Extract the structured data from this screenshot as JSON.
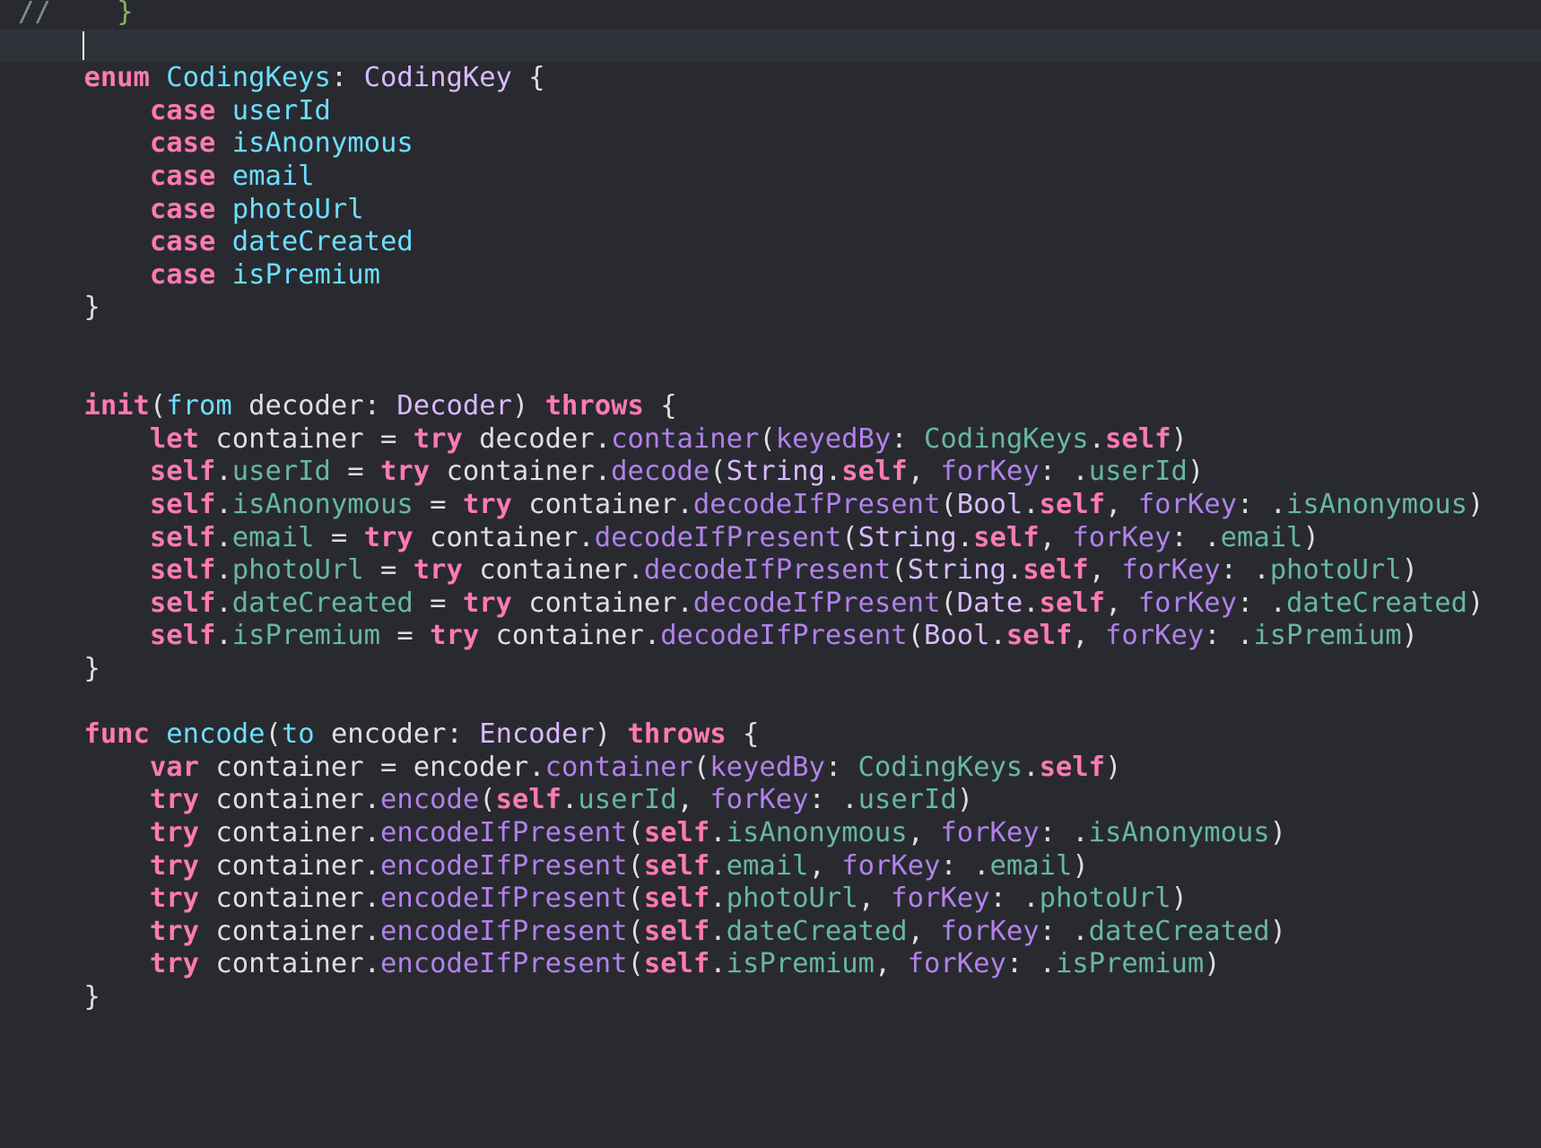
{
  "editor": {
    "theme_colors": {
      "background": "#292a30",
      "current_line": "#2f3239",
      "plain": "#dfdfe0",
      "keyword": "#ff7ab2",
      "type": "#dabaff",
      "declaration": "#6bdfff",
      "member": "#67b7a4",
      "method": "#b281eb",
      "comment": "#7f8c98"
    },
    "current_line_index": 1,
    "lines": [
      [
        {
          "t": "//",
          "c": "comment"
        },
        {
          "t": "    ",
          "c": "plain"
        },
        {
          "t": "}",
          "c": "cmtfold"
        }
      ],
      [],
      [
        {
          "t": "    ",
          "c": "plain"
        },
        {
          "t": "enum",
          "c": "kw"
        },
        {
          "t": " ",
          "c": "plain"
        },
        {
          "t": "CodingKeys",
          "c": "decl"
        },
        {
          "t": ": ",
          "c": "plain"
        },
        {
          "t": "CodingKey",
          "c": "type"
        },
        {
          "t": " {",
          "c": "plain"
        }
      ],
      [
        {
          "t": "        ",
          "c": "plain"
        },
        {
          "t": "case",
          "c": "kw"
        },
        {
          "t": " ",
          "c": "plain"
        },
        {
          "t": "userId",
          "c": "decl"
        }
      ],
      [
        {
          "t": "        ",
          "c": "plain"
        },
        {
          "t": "case",
          "c": "kw"
        },
        {
          "t": " ",
          "c": "plain"
        },
        {
          "t": "isAnonymous",
          "c": "decl"
        }
      ],
      [
        {
          "t": "        ",
          "c": "plain"
        },
        {
          "t": "case",
          "c": "kw"
        },
        {
          "t": " ",
          "c": "plain"
        },
        {
          "t": "email",
          "c": "decl"
        }
      ],
      [
        {
          "t": "        ",
          "c": "plain"
        },
        {
          "t": "case",
          "c": "kw"
        },
        {
          "t": " ",
          "c": "plain"
        },
        {
          "t": "photoUrl",
          "c": "decl"
        }
      ],
      [
        {
          "t": "        ",
          "c": "plain"
        },
        {
          "t": "case",
          "c": "kw"
        },
        {
          "t": " ",
          "c": "plain"
        },
        {
          "t": "dateCreated",
          "c": "decl"
        }
      ],
      [
        {
          "t": "        ",
          "c": "plain"
        },
        {
          "t": "case",
          "c": "kw"
        },
        {
          "t": " ",
          "c": "plain"
        },
        {
          "t": "isPremium",
          "c": "decl"
        }
      ],
      [
        {
          "t": "    }",
          "c": "plain"
        }
      ],
      [],
      [],
      [
        {
          "t": "    ",
          "c": "plain"
        },
        {
          "t": "init",
          "c": "kw"
        },
        {
          "t": "(",
          "c": "plain"
        },
        {
          "t": "from",
          "c": "decl"
        },
        {
          "t": " decoder: ",
          "c": "plain"
        },
        {
          "t": "Decoder",
          "c": "type"
        },
        {
          "t": ") ",
          "c": "plain"
        },
        {
          "t": "throws",
          "c": "kw"
        },
        {
          "t": " {",
          "c": "plain"
        }
      ],
      [
        {
          "t": "        ",
          "c": "plain"
        },
        {
          "t": "let",
          "c": "kw"
        },
        {
          "t": " container = ",
          "c": "plain"
        },
        {
          "t": "try",
          "c": "kw"
        },
        {
          "t": " decoder.",
          "c": "plain"
        },
        {
          "t": "container",
          "c": "method"
        },
        {
          "t": "(",
          "c": "plain"
        },
        {
          "t": "keyedBy",
          "c": "method"
        },
        {
          "t": ": ",
          "c": "plain"
        },
        {
          "t": "CodingKeys",
          "c": "member"
        },
        {
          "t": ".",
          "c": "plain"
        },
        {
          "t": "self",
          "c": "kw"
        },
        {
          "t": ")",
          "c": "plain"
        }
      ],
      [
        {
          "t": "        ",
          "c": "plain"
        },
        {
          "t": "self",
          "c": "kw"
        },
        {
          "t": ".",
          "c": "plain"
        },
        {
          "t": "userId",
          "c": "member"
        },
        {
          "t": " = ",
          "c": "plain"
        },
        {
          "t": "try",
          "c": "kw"
        },
        {
          "t": " container.",
          "c": "plain"
        },
        {
          "t": "decode",
          "c": "method"
        },
        {
          "t": "(",
          "c": "plain"
        },
        {
          "t": "String",
          "c": "type"
        },
        {
          "t": ".",
          "c": "plain"
        },
        {
          "t": "self",
          "c": "kw"
        },
        {
          "t": ", ",
          "c": "plain"
        },
        {
          "t": "forKey",
          "c": "method"
        },
        {
          "t": ": .",
          "c": "plain"
        },
        {
          "t": "userId",
          "c": "member"
        },
        {
          "t": ")",
          "c": "plain"
        }
      ],
      [
        {
          "t": "        ",
          "c": "plain"
        },
        {
          "t": "self",
          "c": "kw"
        },
        {
          "t": ".",
          "c": "plain"
        },
        {
          "t": "isAnonymous",
          "c": "member"
        },
        {
          "t": " = ",
          "c": "plain"
        },
        {
          "t": "try",
          "c": "kw"
        },
        {
          "t": " container.",
          "c": "plain"
        },
        {
          "t": "decodeIfPresent",
          "c": "method"
        },
        {
          "t": "(",
          "c": "plain"
        },
        {
          "t": "Bool",
          "c": "type"
        },
        {
          "t": ".",
          "c": "plain"
        },
        {
          "t": "self",
          "c": "kw"
        },
        {
          "t": ", ",
          "c": "plain"
        },
        {
          "t": "forKey",
          "c": "method"
        },
        {
          "t": ": .",
          "c": "plain"
        },
        {
          "t": "isAnonymous",
          "c": "member"
        },
        {
          "t": ")",
          "c": "plain"
        }
      ],
      [
        {
          "t": "        ",
          "c": "plain"
        },
        {
          "t": "self",
          "c": "kw"
        },
        {
          "t": ".",
          "c": "plain"
        },
        {
          "t": "email",
          "c": "member"
        },
        {
          "t": " = ",
          "c": "plain"
        },
        {
          "t": "try",
          "c": "kw"
        },
        {
          "t": " container.",
          "c": "plain"
        },
        {
          "t": "decodeIfPresent",
          "c": "method"
        },
        {
          "t": "(",
          "c": "plain"
        },
        {
          "t": "String",
          "c": "type"
        },
        {
          "t": ".",
          "c": "plain"
        },
        {
          "t": "self",
          "c": "kw"
        },
        {
          "t": ", ",
          "c": "plain"
        },
        {
          "t": "forKey",
          "c": "method"
        },
        {
          "t": ": .",
          "c": "plain"
        },
        {
          "t": "email",
          "c": "member"
        },
        {
          "t": ")",
          "c": "plain"
        }
      ],
      [
        {
          "t": "        ",
          "c": "plain"
        },
        {
          "t": "self",
          "c": "kw"
        },
        {
          "t": ".",
          "c": "plain"
        },
        {
          "t": "photoUrl",
          "c": "member"
        },
        {
          "t": " = ",
          "c": "plain"
        },
        {
          "t": "try",
          "c": "kw"
        },
        {
          "t": " container.",
          "c": "plain"
        },
        {
          "t": "decodeIfPresent",
          "c": "method"
        },
        {
          "t": "(",
          "c": "plain"
        },
        {
          "t": "String",
          "c": "type"
        },
        {
          "t": ".",
          "c": "plain"
        },
        {
          "t": "self",
          "c": "kw"
        },
        {
          "t": ", ",
          "c": "plain"
        },
        {
          "t": "forKey",
          "c": "method"
        },
        {
          "t": ": .",
          "c": "plain"
        },
        {
          "t": "photoUrl",
          "c": "member"
        },
        {
          "t": ")",
          "c": "plain"
        }
      ],
      [
        {
          "t": "        ",
          "c": "plain"
        },
        {
          "t": "self",
          "c": "kw"
        },
        {
          "t": ".",
          "c": "plain"
        },
        {
          "t": "dateCreated",
          "c": "member"
        },
        {
          "t": " = ",
          "c": "plain"
        },
        {
          "t": "try",
          "c": "kw"
        },
        {
          "t": " container.",
          "c": "plain"
        },
        {
          "t": "decodeIfPresent",
          "c": "method"
        },
        {
          "t": "(",
          "c": "plain"
        },
        {
          "t": "Date",
          "c": "type"
        },
        {
          "t": ".",
          "c": "plain"
        },
        {
          "t": "self",
          "c": "kw"
        },
        {
          "t": ", ",
          "c": "plain"
        },
        {
          "t": "forKey",
          "c": "method"
        },
        {
          "t": ": .",
          "c": "plain"
        },
        {
          "t": "dateCreated",
          "c": "member"
        },
        {
          "t": ")",
          "c": "plain"
        }
      ],
      [
        {
          "t": "        ",
          "c": "plain"
        },
        {
          "t": "self",
          "c": "kw"
        },
        {
          "t": ".",
          "c": "plain"
        },
        {
          "t": "isPremium",
          "c": "member"
        },
        {
          "t": " = ",
          "c": "plain"
        },
        {
          "t": "try",
          "c": "kw"
        },
        {
          "t": " container.",
          "c": "plain"
        },
        {
          "t": "decodeIfPresent",
          "c": "method"
        },
        {
          "t": "(",
          "c": "plain"
        },
        {
          "t": "Bool",
          "c": "type"
        },
        {
          "t": ".",
          "c": "plain"
        },
        {
          "t": "self",
          "c": "kw"
        },
        {
          "t": ", ",
          "c": "plain"
        },
        {
          "t": "forKey",
          "c": "method"
        },
        {
          "t": ": .",
          "c": "plain"
        },
        {
          "t": "isPremium",
          "c": "member"
        },
        {
          "t": ")",
          "c": "plain"
        }
      ],
      [
        {
          "t": "    }",
          "c": "plain"
        }
      ],
      [],
      [
        {
          "t": "    ",
          "c": "plain"
        },
        {
          "t": "func",
          "c": "kw"
        },
        {
          "t": " ",
          "c": "plain"
        },
        {
          "t": "encode",
          "c": "decl"
        },
        {
          "t": "(",
          "c": "plain"
        },
        {
          "t": "to",
          "c": "decl"
        },
        {
          "t": " encoder: ",
          "c": "plain"
        },
        {
          "t": "Encoder",
          "c": "type"
        },
        {
          "t": ") ",
          "c": "plain"
        },
        {
          "t": "throws",
          "c": "kw"
        },
        {
          "t": " {",
          "c": "plain"
        }
      ],
      [
        {
          "t": "        ",
          "c": "plain"
        },
        {
          "t": "var",
          "c": "kw"
        },
        {
          "t": " container = encoder.",
          "c": "plain"
        },
        {
          "t": "container",
          "c": "method"
        },
        {
          "t": "(",
          "c": "plain"
        },
        {
          "t": "keyedBy",
          "c": "method"
        },
        {
          "t": ": ",
          "c": "plain"
        },
        {
          "t": "CodingKeys",
          "c": "member"
        },
        {
          "t": ".",
          "c": "plain"
        },
        {
          "t": "self",
          "c": "kw"
        },
        {
          "t": ")",
          "c": "plain"
        }
      ],
      [
        {
          "t": "        ",
          "c": "plain"
        },
        {
          "t": "try",
          "c": "kw"
        },
        {
          "t": " container.",
          "c": "plain"
        },
        {
          "t": "encode",
          "c": "method"
        },
        {
          "t": "(",
          "c": "plain"
        },
        {
          "t": "self",
          "c": "kw"
        },
        {
          "t": ".",
          "c": "plain"
        },
        {
          "t": "userId",
          "c": "member"
        },
        {
          "t": ", ",
          "c": "plain"
        },
        {
          "t": "forKey",
          "c": "method"
        },
        {
          "t": ": .",
          "c": "plain"
        },
        {
          "t": "userId",
          "c": "member"
        },
        {
          "t": ")",
          "c": "plain"
        }
      ],
      [
        {
          "t": "        ",
          "c": "plain"
        },
        {
          "t": "try",
          "c": "kw"
        },
        {
          "t": " container.",
          "c": "plain"
        },
        {
          "t": "encodeIfPresent",
          "c": "method"
        },
        {
          "t": "(",
          "c": "plain"
        },
        {
          "t": "self",
          "c": "kw"
        },
        {
          "t": ".",
          "c": "plain"
        },
        {
          "t": "isAnonymous",
          "c": "member"
        },
        {
          "t": ", ",
          "c": "plain"
        },
        {
          "t": "forKey",
          "c": "method"
        },
        {
          "t": ": .",
          "c": "plain"
        },
        {
          "t": "isAnonymous",
          "c": "member"
        },
        {
          "t": ")",
          "c": "plain"
        }
      ],
      [
        {
          "t": "        ",
          "c": "plain"
        },
        {
          "t": "try",
          "c": "kw"
        },
        {
          "t": " container.",
          "c": "plain"
        },
        {
          "t": "encodeIfPresent",
          "c": "method"
        },
        {
          "t": "(",
          "c": "plain"
        },
        {
          "t": "self",
          "c": "kw"
        },
        {
          "t": ".",
          "c": "plain"
        },
        {
          "t": "email",
          "c": "member"
        },
        {
          "t": ", ",
          "c": "plain"
        },
        {
          "t": "forKey",
          "c": "method"
        },
        {
          "t": ": .",
          "c": "plain"
        },
        {
          "t": "email",
          "c": "member"
        },
        {
          "t": ")",
          "c": "plain"
        }
      ],
      [
        {
          "t": "        ",
          "c": "plain"
        },
        {
          "t": "try",
          "c": "kw"
        },
        {
          "t": " container.",
          "c": "plain"
        },
        {
          "t": "encodeIfPresent",
          "c": "method"
        },
        {
          "t": "(",
          "c": "plain"
        },
        {
          "t": "self",
          "c": "kw"
        },
        {
          "t": ".",
          "c": "plain"
        },
        {
          "t": "photoUrl",
          "c": "member"
        },
        {
          "t": ", ",
          "c": "plain"
        },
        {
          "t": "forKey",
          "c": "method"
        },
        {
          "t": ": .",
          "c": "plain"
        },
        {
          "t": "photoUrl",
          "c": "member"
        },
        {
          "t": ")",
          "c": "plain"
        }
      ],
      [
        {
          "t": "        ",
          "c": "plain"
        },
        {
          "t": "try",
          "c": "kw"
        },
        {
          "t": " container.",
          "c": "plain"
        },
        {
          "t": "encodeIfPresent",
          "c": "method"
        },
        {
          "t": "(",
          "c": "plain"
        },
        {
          "t": "self",
          "c": "kw"
        },
        {
          "t": ".",
          "c": "plain"
        },
        {
          "t": "dateCreated",
          "c": "member"
        },
        {
          "t": ", ",
          "c": "plain"
        },
        {
          "t": "forKey",
          "c": "method"
        },
        {
          "t": ": .",
          "c": "plain"
        },
        {
          "t": "dateCreated",
          "c": "member"
        },
        {
          "t": ")",
          "c": "plain"
        }
      ],
      [
        {
          "t": "        ",
          "c": "plain"
        },
        {
          "t": "try",
          "c": "kw"
        },
        {
          "t": " container.",
          "c": "plain"
        },
        {
          "t": "encodeIfPresent",
          "c": "method"
        },
        {
          "t": "(",
          "c": "plain"
        },
        {
          "t": "self",
          "c": "kw"
        },
        {
          "t": ".",
          "c": "plain"
        },
        {
          "t": "isPremium",
          "c": "member"
        },
        {
          "t": ", ",
          "c": "plain"
        },
        {
          "t": "forKey",
          "c": "method"
        },
        {
          "t": ": .",
          "c": "plain"
        },
        {
          "t": "isPremium",
          "c": "member"
        },
        {
          "t": ")",
          "c": "plain"
        }
      ],
      [
        {
          "t": "    }",
          "c": "plain"
        }
      ]
    ]
  }
}
